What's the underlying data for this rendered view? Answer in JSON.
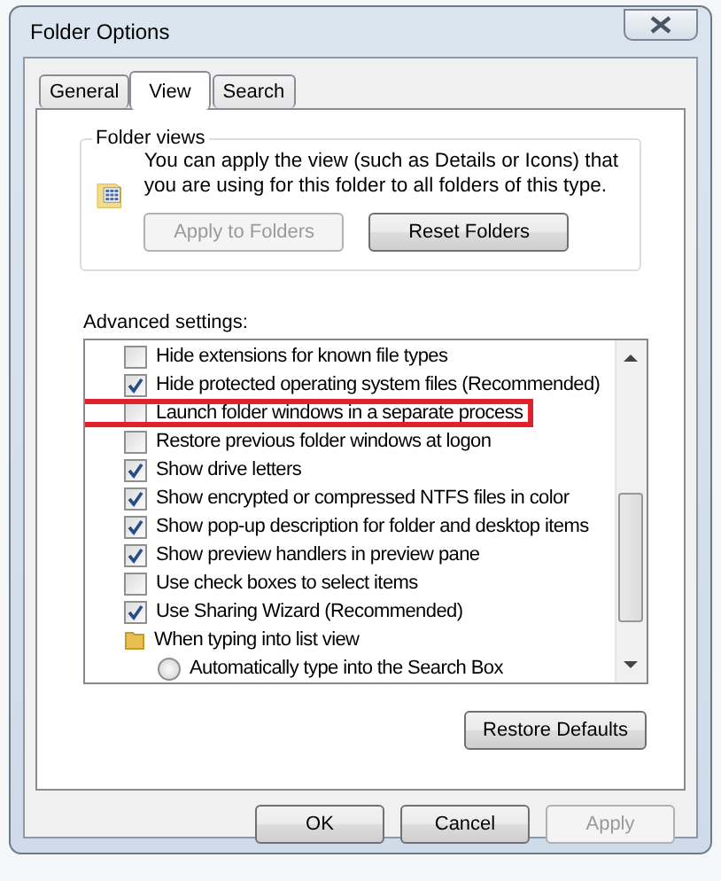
{
  "window": {
    "title": "Folder Options"
  },
  "tabs": [
    {
      "label": "General",
      "selected": false
    },
    {
      "label": "View",
      "selected": true
    },
    {
      "label": "Search",
      "selected": false
    }
  ],
  "folder_views": {
    "title": "Folder views",
    "description": "You can apply the view (such as Details or Icons) that you are using for this folder to all folders of this type.",
    "buttons": [
      {
        "label": "Apply to Folders",
        "disabled": true
      },
      {
        "label": "Reset Folders",
        "disabled": false
      }
    ]
  },
  "advanced_settings": {
    "label": "Advanced settings:",
    "items": [
      {
        "kind": "checkbox",
        "label": "Hide extensions for known file types",
        "checked": false,
        "highlighted": false
      },
      {
        "kind": "checkbox",
        "label": "Hide protected operating system files (Recommended)",
        "checked": true,
        "highlighted": false
      },
      {
        "kind": "checkbox",
        "label": "Launch folder windows in a separate process",
        "checked": false,
        "highlighted": true
      },
      {
        "kind": "checkbox",
        "label": "Restore previous folder windows at logon",
        "checked": false,
        "highlighted": false
      },
      {
        "kind": "checkbox",
        "label": "Show drive letters",
        "checked": true,
        "highlighted": false
      },
      {
        "kind": "checkbox",
        "label": "Show encrypted or compressed NTFS files in color",
        "checked": true,
        "highlighted": false
      },
      {
        "kind": "checkbox",
        "label": "Show pop-up description for folder and desktop items",
        "checked": true,
        "highlighted": false
      },
      {
        "kind": "checkbox",
        "label": "Show preview handlers in preview pane",
        "checked": true,
        "highlighted": false
      },
      {
        "kind": "checkbox",
        "label": "Use check boxes to select items",
        "checked": false,
        "highlighted": false
      },
      {
        "kind": "checkbox",
        "label": "Use Sharing Wizard (Recommended)",
        "checked": true,
        "highlighted": false
      },
      {
        "kind": "folder",
        "label": "When typing into list view"
      },
      {
        "kind": "radio",
        "label": "Automatically type into the Search Box",
        "checked": false,
        "highlighted": false
      }
    ],
    "restore_button": {
      "label": "Restore Defaults",
      "disabled": false
    }
  },
  "buttons": [
    {
      "label": "OK",
      "disabled": false
    },
    {
      "label": "Cancel",
      "disabled": false
    },
    {
      "label": "Apply",
      "disabled": true
    }
  ]
}
